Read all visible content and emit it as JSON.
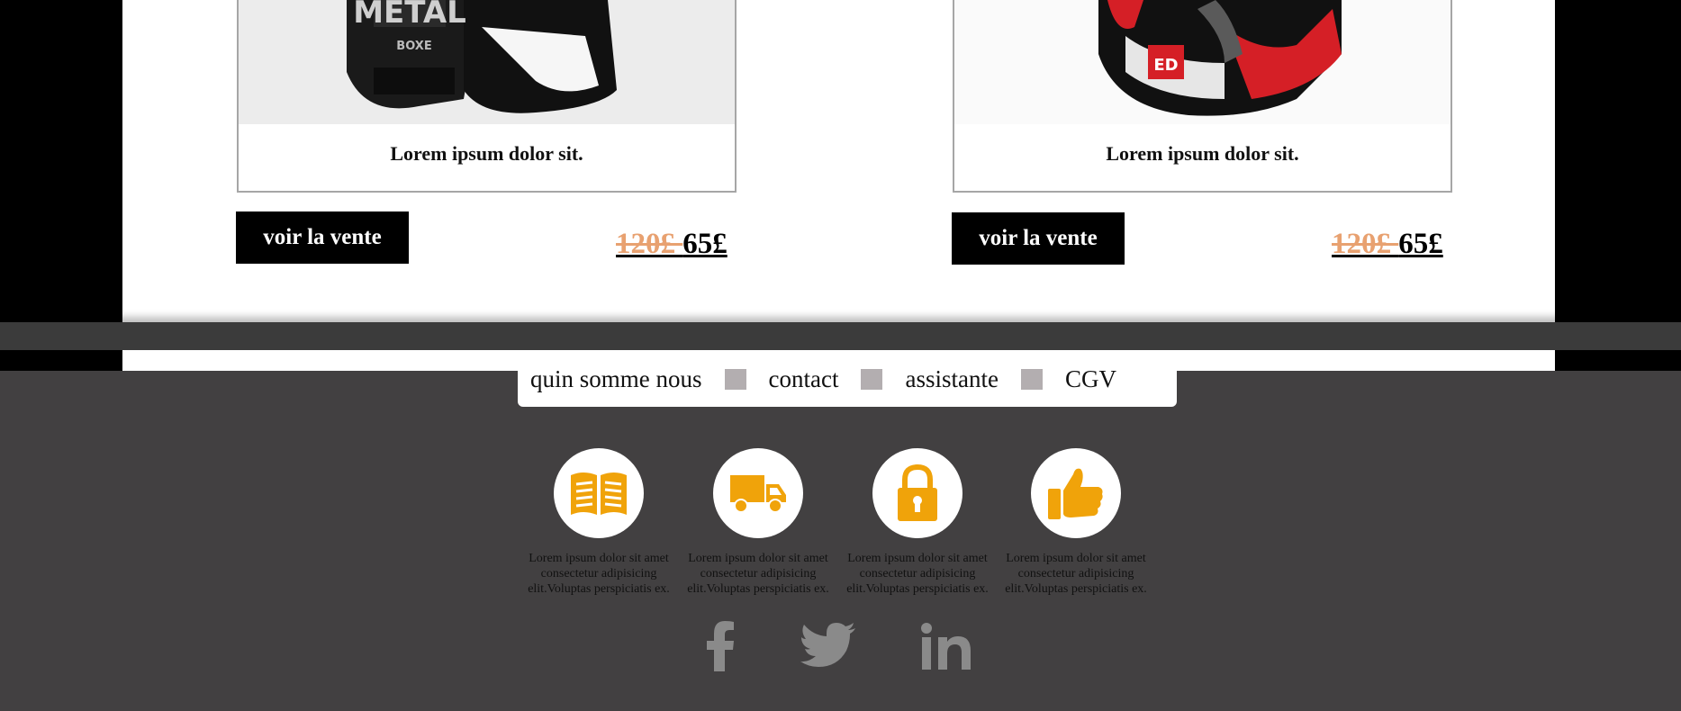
{
  "products": [
    {
      "title": "Lorem ipsum dolor sit.",
      "button": "voir la vente",
      "old_price": "120£ ",
      "new_price": "65£",
      "image": "boxing-glove-black-metal"
    },
    {
      "title": "Lorem ipsum dolor sit.",
      "button": "voir la vente",
      "old_price": "120£ ",
      "new_price": "65£",
      "image": "boxing-glove-red-black"
    }
  ],
  "nav": {
    "items": [
      "quin somme nous",
      "contact",
      "assistante",
      "CGV"
    ]
  },
  "features": [
    {
      "icon": "book-icon",
      "text": "Lorem ipsum dolor sit amet consectetur adipisicing elit.Voluptas perspiciatis ex."
    },
    {
      "icon": "truck-icon",
      "text": "Lorem ipsum dolor sit amet consectetur adipisicing elit.Voluptas perspiciatis ex."
    },
    {
      "icon": "lock-icon",
      "text": "Lorem ipsum dolor sit amet consectetur adipisicing elit.Voluptas perspiciatis ex."
    },
    {
      "icon": "thumbs-up-icon",
      "text": "Lorem ipsum dolor sit amet consectetur adipisicing elit.Voluptas perspiciatis ex."
    }
  ],
  "social": [
    "facebook-icon",
    "twitter-icon",
    "linkedin-icon"
  ],
  "colors": {
    "accent": "#f0a30a",
    "old_price": "#e8a170",
    "footer_bg": "#424041",
    "separator": "#b3aeb0",
    "social_icon": "#8a8a8a"
  }
}
